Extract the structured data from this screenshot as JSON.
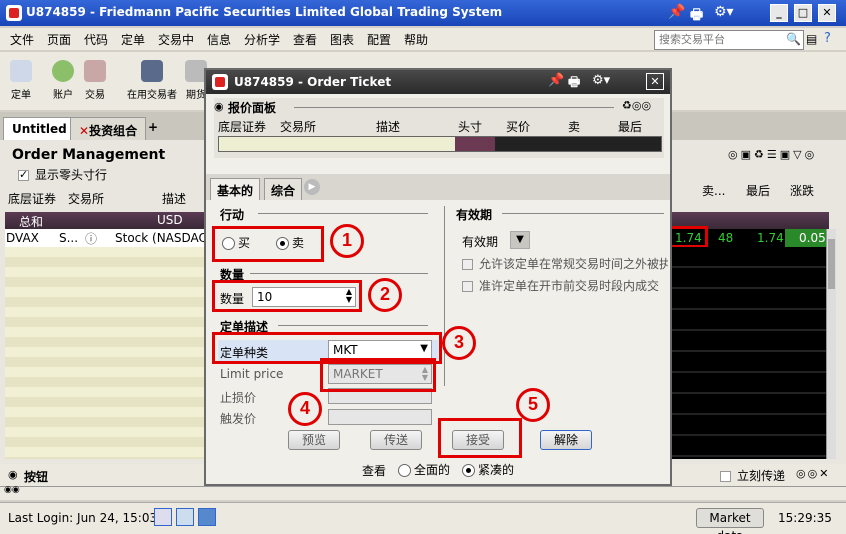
{
  "window": {
    "title": "U874859 - Friedmann Pacific Securities Limited Global Trading System",
    "min": "_",
    "max": "□",
    "close": "✕"
  },
  "menu": [
    "文件",
    "页面",
    "代码",
    "定单",
    "交易中",
    "信息",
    "分析学",
    "查看",
    "图表",
    "配置",
    "帮助"
  ],
  "search": {
    "placeholder": "搜索交易平台"
  },
  "toolbar": [
    "定单",
    "账户",
    "交易",
    "在用交易者",
    "期货"
  ],
  "tabs": {
    "untitled": "Untitled",
    "portfolio": "投资组合",
    "add": "+"
  },
  "order_mgmt": {
    "title": "Order Management",
    "show_odd_lots": "显示零头寸行",
    "columns": [
      "底层证券",
      "交易所",
      "描述"
    ],
    "right_columns": [
      "卖...",
      "最后",
      "涨跌"
    ],
    "total_label": "总和",
    "total_currency": "USD",
    "row": {
      "symbol": "DVAX",
      "exch": "S...",
      "desc": "Stock (NASDAQ",
      "bid": "1.74",
      "ask_size": "48",
      "ask": "1.74",
      "change": "0.05"
    }
  },
  "bottom": {
    "buttons_label": "按钮",
    "transmit": "立刻传递"
  },
  "status": {
    "last_login": "Last Login: Jun 24, 15:03",
    "market_data": "Market data",
    "time": "15:29:35"
  },
  "dialog": {
    "title": "U874859 - Order Ticket",
    "close": "✕",
    "quote_panel": {
      "title": "报价面板",
      "columns": [
        "底层证券",
        "交易所",
        "描述",
        "头寸",
        "买价",
        "卖",
        "最后"
      ]
    },
    "tabs": [
      "基本的",
      "综合"
    ],
    "action": {
      "title": "行动",
      "buy": "买",
      "sell": "卖"
    },
    "quantity": {
      "title": "数量",
      "label": "数量",
      "value": "10"
    },
    "order_desc": {
      "title": "定单描述",
      "type_label": "定单种类",
      "type_value": "MKT",
      "limit_label": "Limit price",
      "limit_value": "MARKET",
      "stop_label": "止损价",
      "trigger_label": "触发价"
    },
    "validity": {
      "title": "有效期",
      "label": "有效期",
      "opt1": "允许该定单在常规交易时间之外被执",
      "opt2": "准许定单在开市前交易时段内成交"
    },
    "buttons": {
      "preview": "预览",
      "transmit": "传送",
      "accept": "接受",
      "cancel": "解除"
    },
    "view": {
      "label": "查看",
      "full": "全面的",
      "compact": "紧凑的"
    }
  },
  "annotations": [
    "1",
    "2",
    "3",
    "4",
    "5"
  ],
  "colors": {
    "accent_red": "#e00000",
    "title_blue": "#1846b8",
    "green_text": "#33cc33"
  }
}
